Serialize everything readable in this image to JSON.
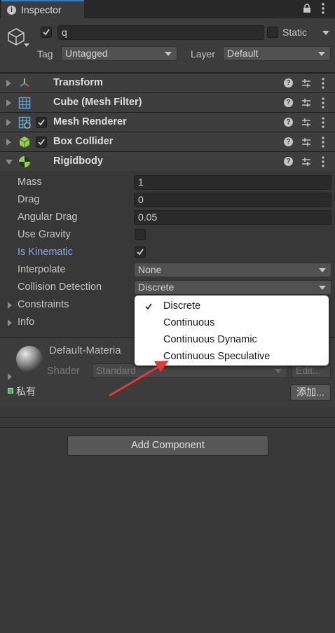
{
  "tab": {
    "title": "Inspector"
  },
  "object": {
    "name": "q",
    "active": true,
    "static_label": "Static",
    "tag_label": "Tag",
    "tag_value": "Untagged",
    "layer_label": "Layer",
    "layer_value": "Default"
  },
  "components": [
    {
      "title": "Transform",
      "icon": "transform-icon"
    },
    {
      "title": "Cube (Mesh Filter)",
      "icon": "mesh-filter-icon"
    },
    {
      "title": "Mesh Renderer",
      "icon": "mesh-renderer-icon",
      "enabled": true
    },
    {
      "title": "Box Collider",
      "icon": "box-collider-icon",
      "enabled": true
    },
    {
      "title": "Rigidbody",
      "icon": "rigidbody-icon",
      "expanded": true
    }
  ],
  "rigidbody": {
    "mass_label": "Mass",
    "mass_value": "1",
    "drag_label": "Drag",
    "drag_value": "0",
    "angular_drag_label": "Angular Drag",
    "angular_drag_value": "0.05",
    "use_gravity_label": "Use Gravity",
    "use_gravity": false,
    "is_kinematic_label": "Is Kinematic",
    "is_kinematic": true,
    "interpolate_label": "Interpolate",
    "interpolate_value": "None",
    "collision_label": "Collision Detection",
    "collision_value": "Discrete",
    "constraints_label": "Constraints",
    "info_label": "Info"
  },
  "dropdown_options": [
    "Discrete",
    "Continuous",
    "Continuous Dynamic",
    "Continuous Speculative"
  ],
  "dropdown_selected": "Discrete",
  "material": {
    "name": "Default-Materia",
    "shader_label": "Shader",
    "shader_value": "Standard",
    "edit_label": "Edit..."
  },
  "private_label": "私有",
  "add_label": "添加...",
  "add_component_label": "Add Component",
  "colors": {
    "accent": "#3a79bb",
    "annotation_arrow": "#e53935",
    "highlight_label": "#7bacf0"
  }
}
